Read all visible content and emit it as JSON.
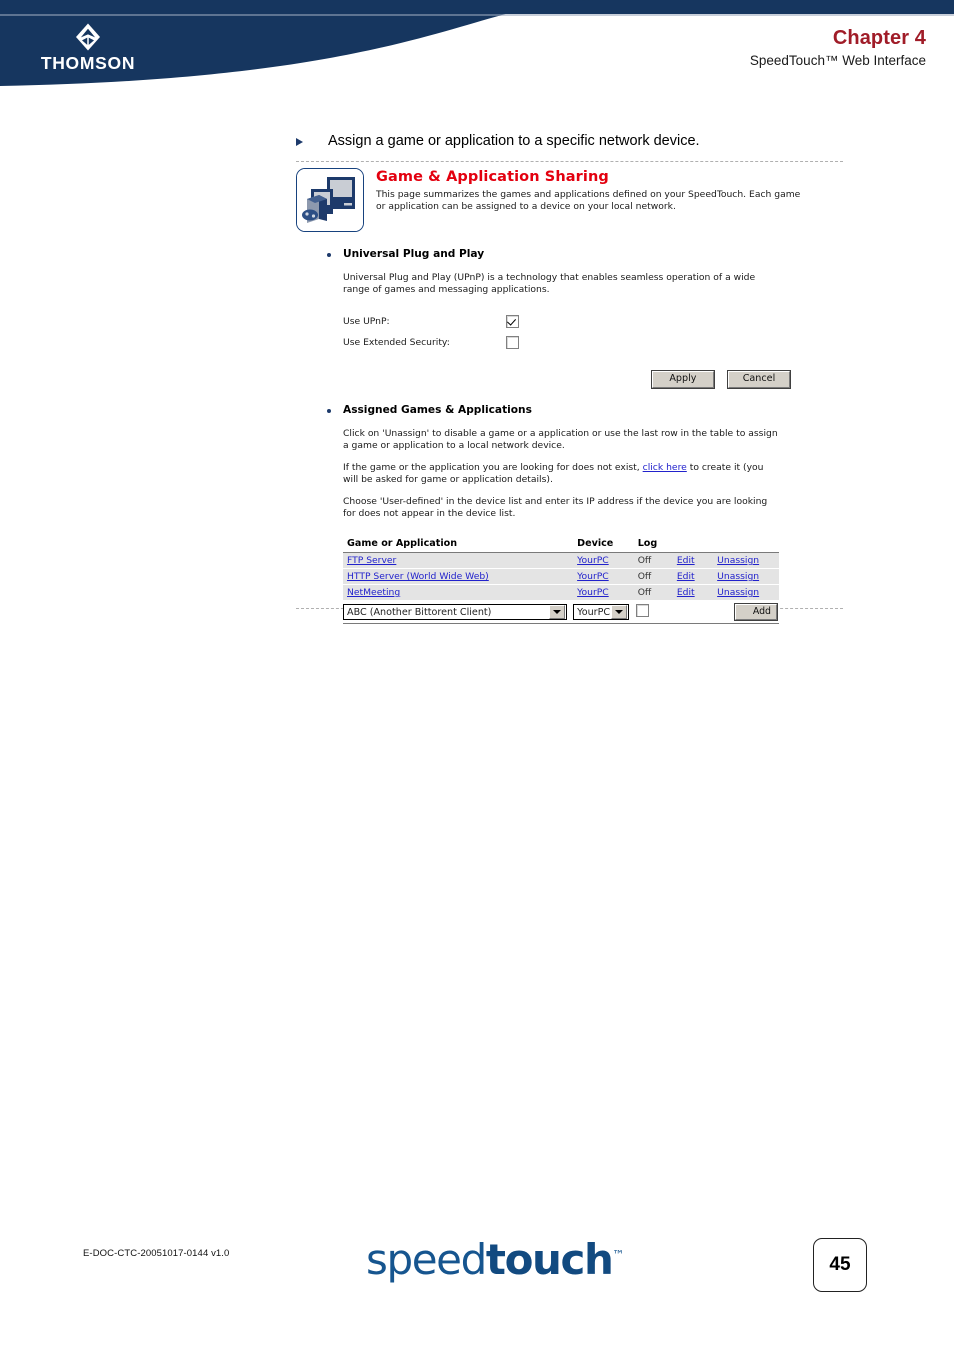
{
  "header": {
    "brand": "THOMSON",
    "chapter": "Chapter 4",
    "subtitle": "SpeedTouch™ Web Interface"
  },
  "instruction": {
    "bullet_text": "Assign a game or application to a specific network device."
  },
  "webui": {
    "panel_title": "Game & Application Sharing",
    "panel_description": "This page summarizes the games and applications defined on your SpeedTouch. Each game or application can be assigned to a device on your local network.",
    "upnp": {
      "section_title": "Universal Plug and Play",
      "description": "Universal Plug and Play (UPnP) is a technology that enables seamless operation of a wide range of games and messaging applications.",
      "fields": [
        {
          "label": "Use UPnP:",
          "checked": true
        },
        {
          "label": "Use Extended Security:",
          "checked": false
        }
      ],
      "apply_label": "Apply",
      "cancel_label": "Cancel"
    },
    "assigned": {
      "section_title": "Assigned Games & Applications",
      "para1": "Click on 'Unassign' to disable a game or a application or use the last row in the table to assign a game or application to a local network device.",
      "para2_pre": "If the game or the application you are looking for does not exist, ",
      "para2_link": "click here",
      "para2_post": " to create it (you will be asked for game or application details).",
      "para3": "Choose 'User-defined' in the device list and enter its IP address if the device you are looking for does not appear in the device list.",
      "table": {
        "headers": [
          "Game or Application",
          "Device",
          "Log",
          "",
          ""
        ],
        "rows": [
          {
            "app": "FTP Server",
            "device": "YourPC",
            "log": "Off",
            "edit": "Edit",
            "unassign": "Unassign"
          },
          {
            "app": "HTTP Server (World Wide Web)",
            "device": "YourPC",
            "log": "Off",
            "edit": "Edit",
            "unassign": "Unassign"
          },
          {
            "app": "NetMeeting",
            "device": "YourPC",
            "log": "Off",
            "edit": "Edit",
            "unassign": "Unassign"
          }
        ],
        "add_row": {
          "app_selected": "ABC (Another Bittorent Client)",
          "device_selected": "YourPC",
          "log_checked": false,
          "add_label": "Add"
        }
      }
    }
  },
  "footer": {
    "doc_code": "E-DOC-CTC-20051017-0144 v1.0",
    "logo_light": "speed",
    "logo_bold": "touch",
    "logo_tm": "™",
    "page_number": "45"
  },
  "colors": {
    "header_blue": "#16365f",
    "chapter_red": "#A01C28",
    "panel_title_red": "#E3000F",
    "link_blue": "#2222cc",
    "table_row_gray": "#e4e4e4"
  }
}
